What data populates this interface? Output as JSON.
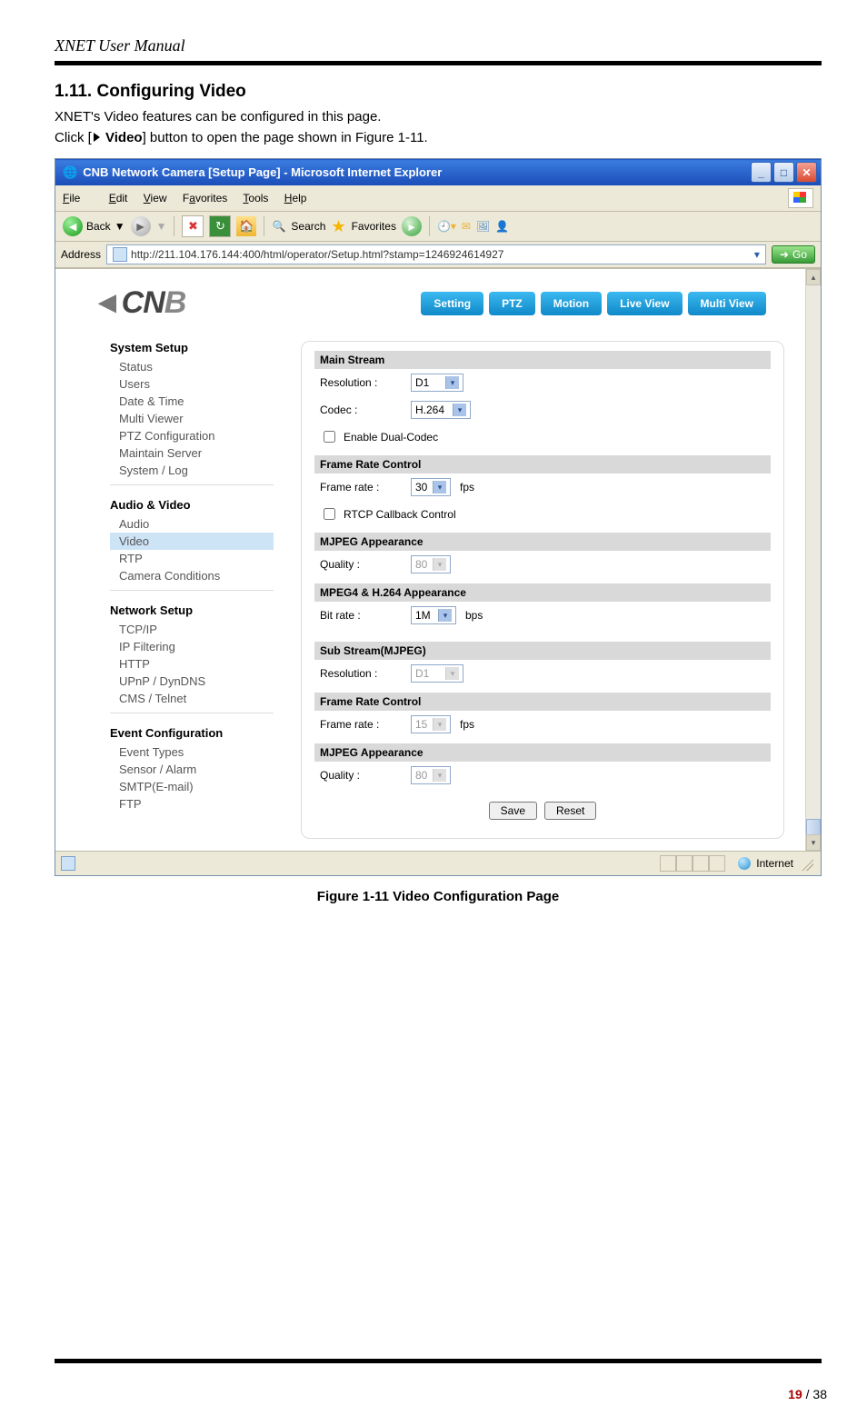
{
  "doc": {
    "manual_title": "XNET User Manual",
    "section_heading": "1.11. Configuring Video",
    "intro_line": "XNET's Video features can be configured in this page.",
    "click_prefix": "Click [",
    "click_bold": " Video",
    "click_suffix": "] button to open the page shown in Figure 1-11.",
    "figure_caption": "Figure 1-11 Video Configuration Page",
    "page_current": "19",
    "page_sep": " / ",
    "page_total": "38"
  },
  "window": {
    "title": "CNB Network Camera [Setup Page] - Microsoft Internet Explorer",
    "menus": [
      "File",
      "Edit",
      "View",
      "Favorites",
      "Tools",
      "Help"
    ],
    "toolbar": {
      "back": "Back",
      "search": "Search",
      "favorites": "Favorites"
    },
    "address_label": "Address",
    "address_url": "http://211.104.176.144:400/html/operator/Setup.html?stamp=1246924614927",
    "go": "Go",
    "status_text": "Internet"
  },
  "page": {
    "logo": "CNB",
    "tabs": [
      "Setting",
      "PTZ",
      "Motion",
      "Live View",
      "Multi View"
    ],
    "sidebar": {
      "groups": [
        {
          "title": "System Setup",
          "items": [
            "Status",
            "Users",
            "Date & Time",
            "Multi Viewer",
            "PTZ Configuration",
            "Maintain Server",
            "System / Log"
          ]
        },
        {
          "title": "Audio & Video",
          "items": [
            "Audio",
            "Video",
            "RTP",
            "Camera Conditions"
          ],
          "active": "Video"
        },
        {
          "title": "Network Setup",
          "items": [
            "TCP/IP",
            "IP Filtering",
            "HTTP",
            "UPnP / DynDNS",
            "CMS / Telnet"
          ]
        },
        {
          "title": "Event Configuration",
          "items": [
            "Event Types",
            "Sensor / Alarm",
            "SMTP(E-mail)",
            "FTP"
          ]
        }
      ]
    },
    "form": {
      "main_stream": "Main Stream",
      "resolution_label": "Resolution :",
      "resolution_value": "D1",
      "codec_label": "Codec :",
      "codec_value": "H.264",
      "enable_dual": "Enable Dual-Codec",
      "frame_rate_control": "Frame Rate Control",
      "frame_rate_label": "Frame rate :",
      "frame_rate_value": "30",
      "fps": "fps",
      "rtcp": "RTCP Callback Control",
      "mjpeg_appearance": "MJPEG Appearance",
      "quality_label": "Quality :",
      "quality_value": "80",
      "mpeg4_h264": "MPEG4 & H.264 Appearance",
      "bitrate_label": "Bit rate :",
      "bitrate_value": "1M",
      "bps": "bps",
      "sub_stream": "Sub Stream(MJPEG)",
      "sub_resolution_value": "D1",
      "sub_frame_rate_value": "15",
      "sub_quality_value": "80",
      "save": "Save",
      "reset": "Reset"
    }
  }
}
